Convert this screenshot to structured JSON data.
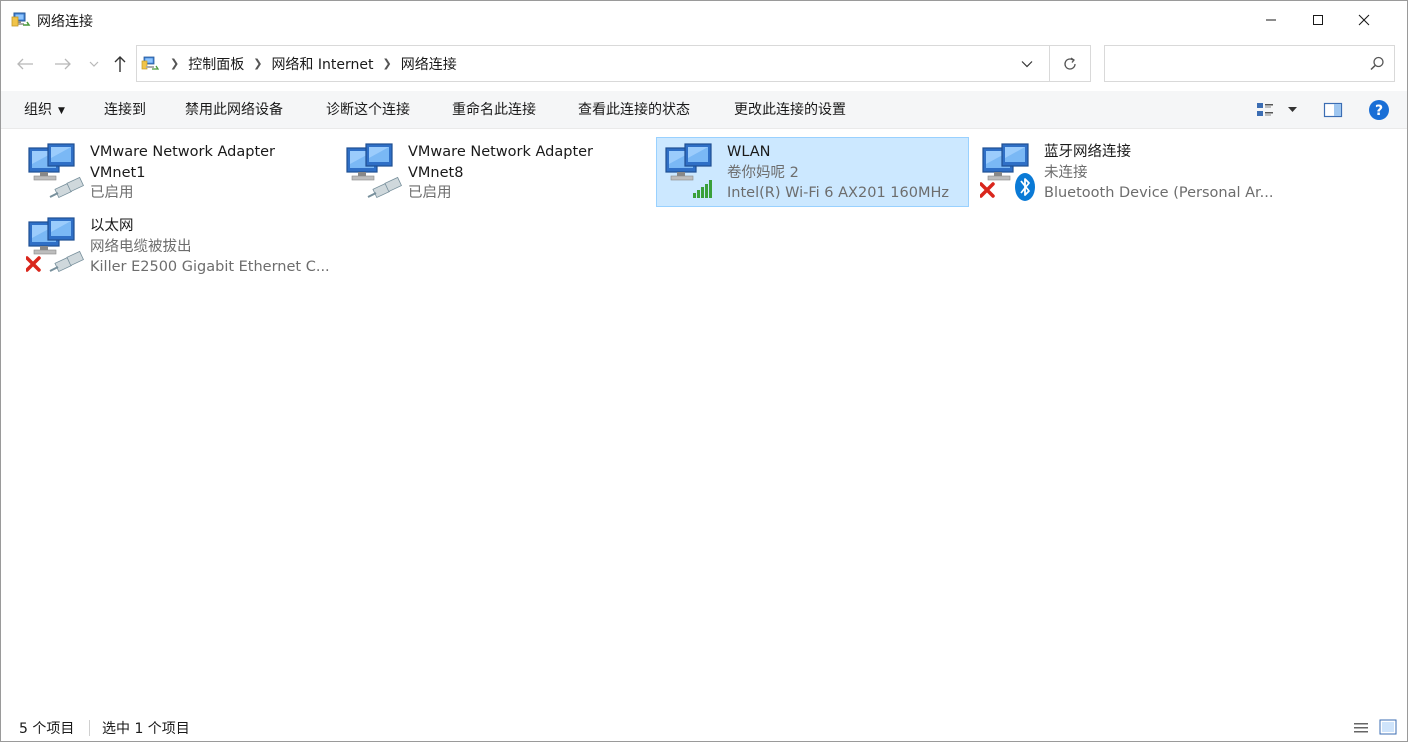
{
  "window": {
    "title": "网络连接"
  },
  "breadcrumbs": [
    "控制面板",
    "网络和 Internet",
    "网络连接"
  ],
  "search": {
    "placeholder": ""
  },
  "commands": {
    "organize": "组织",
    "connect_to": "连接到",
    "disable": "禁用此网络设备",
    "diagnose": "诊断这个连接",
    "rename": "重命名此连接",
    "view_status": "查看此连接的状态",
    "change_settings": "更改此连接的设置"
  },
  "connections": [
    {
      "name": "VMware Network Adapter VMnet1",
      "status": "已启用",
      "device": "",
      "icon": "network-adapter-icon",
      "badge": "cable",
      "selected": false
    },
    {
      "name": "VMware Network Adapter VMnet8",
      "status": "已启用",
      "device": "",
      "icon": "network-adapter-icon",
      "badge": "cable",
      "selected": false
    },
    {
      "name": "WLAN",
      "status": "卷你妈呢 2",
      "device": "Intel(R) Wi-Fi 6 AX201 160MHz",
      "icon": "wifi-adapter-icon",
      "badge": "signal-bars",
      "selected": true
    },
    {
      "name": "蓝牙网络连接",
      "status": "未连接",
      "device": "Bluetooth Device (Personal Ar...",
      "icon": "bluetooth-adapter-icon",
      "badge": "bluetooth",
      "disconnected": true,
      "selected": false
    },
    {
      "name": "以太网",
      "status": "网络电缆被拔出",
      "device": "Killer E2500 Gigabit Ethernet C...",
      "icon": "ethernet-adapter-icon",
      "badge": "cable",
      "disconnected": true,
      "selected": false
    }
  ],
  "statusbar": {
    "count": "5 个项目",
    "selected": "选中 1 个项目"
  },
  "colors": {
    "selection_bg": "#cce8ff",
    "selection_border": "#99d1ff",
    "help_blue": "#1a6fd6",
    "signal_green": "#3aa03a",
    "error_red": "#d9261c",
    "bluetooth_blue": "#0a7ad6"
  }
}
